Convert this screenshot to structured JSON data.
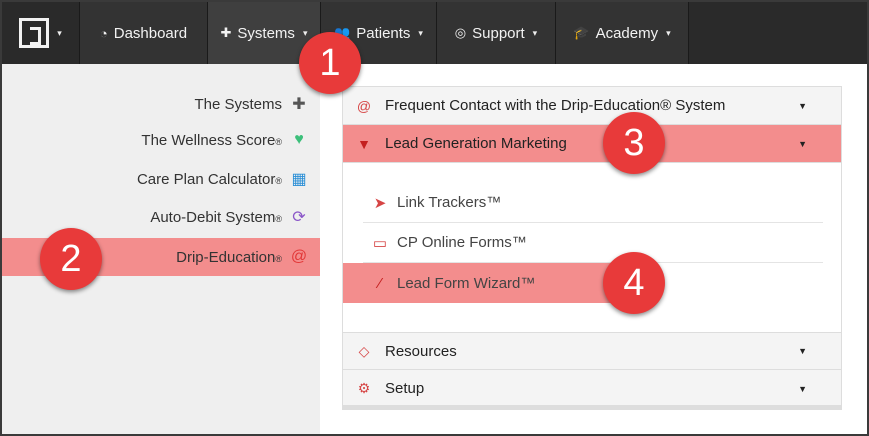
{
  "nav": {
    "items": [
      {
        "label": "Dashboard",
        "icon": "dashboard-icon",
        "glyph": "◔"
      },
      {
        "label": "Systems",
        "icon": "puzzle-icon",
        "glyph": "✚"
      },
      {
        "label": "Patients",
        "icon": "users-icon",
        "glyph": "👥"
      },
      {
        "label": "Support",
        "icon": "lifebuoy-icon",
        "glyph": "◎"
      },
      {
        "label": "Academy",
        "icon": "graduation-cap-icon",
        "glyph": "🎓"
      }
    ],
    "caret": "▾"
  },
  "sidebar": {
    "items": [
      {
        "label": "The Systems",
        "reg": "",
        "icon": "puzzle-icon",
        "glyph": "✚",
        "color": "#555555"
      },
      {
        "label": "The Wellness Score",
        "reg": "®",
        "icon": "heartbeat-icon",
        "glyph": "♥",
        "color": "#3cbf7a"
      },
      {
        "label": "Care Plan Calculator",
        "reg": "®",
        "icon": "calculator-icon",
        "glyph": "▦",
        "color": "#2b8fd6"
      },
      {
        "label": "Auto-Debit System",
        "reg": "®",
        "icon": "refresh-icon",
        "glyph": "⟳",
        "color": "#8a55c8"
      },
      {
        "label": "Drip-Education",
        "reg": "®",
        "icon": "at-icon",
        "glyph": "@",
        "color": "#e23838"
      }
    ]
  },
  "accordion": {
    "frequent": {
      "label": "Frequent Contact with the Drip-Education® System",
      "glyph": "@"
    },
    "lead": {
      "label": "Lead Generation Marketing",
      "glyph": "▼"
    },
    "resources": {
      "label": "Resources",
      "glyph": "◇"
    },
    "setup": {
      "label": "Setup",
      "glyph": "⚙"
    },
    "dropdown": "▼"
  },
  "lead_items": [
    {
      "label": "Link Trackers™",
      "glyph": "➤"
    },
    {
      "label": "CP Online Forms™",
      "glyph": "▭"
    },
    {
      "label": "Lead Form Wizard™",
      "glyph": "⁄"
    }
  ],
  "callouts": [
    "1",
    "2",
    "3",
    "4"
  ],
  "colors": {
    "highlight": "#f38d8d",
    "badge": "#e83a3a",
    "nav": "#2e2e2e"
  }
}
